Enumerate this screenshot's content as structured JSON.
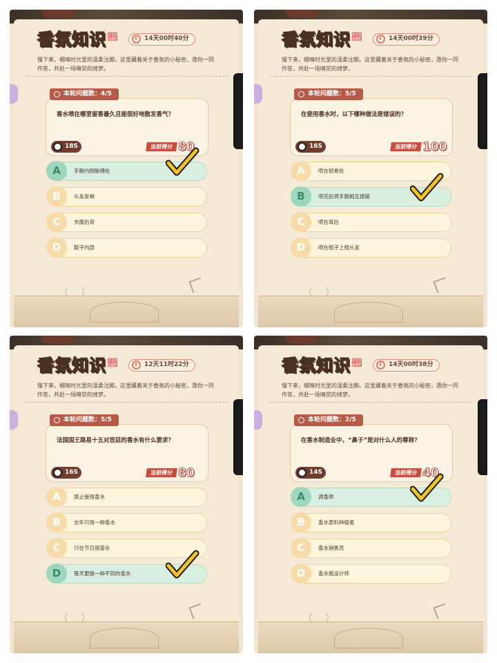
{
  "title_part1": "香氛",
  "title_part2": "知识",
  "description": "慢下来，细嗅时光里的温柔注脚。这里藏着关于香氛的小秘密，邀你一同作答，共赴一场嗅觉的绮梦。",
  "score_label": "当前得分",
  "colors": {
    "accent": "#b85a48",
    "correct": "#d8efe2",
    "option": "#fdf6dc",
    "check": "#f3c22b"
  },
  "panels": [
    {
      "timer": "14天00时40分",
      "round": "本轮问题数：4/5",
      "question": "香水喷在哪里留香最久且能很好地散发香气？",
      "time_left": "18S",
      "score": "80",
      "correct_index": 0,
      "options": [
        {
          "letter": "A",
          "text": "手腕内侧脉搏处"
        },
        {
          "letter": "B",
          "text": "头发发梢"
        },
        {
          "letter": "C",
          "text": "衣服后背"
        },
        {
          "letter": "D",
          "text": "鞋子内部"
        }
      ]
    },
    {
      "timer": "14天00时39分",
      "round": "本轮问题数：5/5",
      "question": "在使用香水时，以下哪种做法是错误的？",
      "time_left": "16S",
      "score": "100",
      "correct_index": 1,
      "options": [
        {
          "letter": "A",
          "text": "喷在锁骨处"
        },
        {
          "letter": "B",
          "text": "喷完后将手腕相互揉搓"
        },
        {
          "letter": "C",
          "text": "喷在耳后"
        },
        {
          "letter": "D",
          "text": "喷在梳子上梳头发"
        }
      ]
    },
    {
      "timer": "12天11时22分",
      "round": "本轮问题数：5/5",
      "question": "法国国王路易十五对宫廷的香水有什么要求？",
      "time_left": "16S",
      "score": "80",
      "correct_index": 3,
      "options": [
        {
          "letter": "A",
          "text": "禁止使用香水"
        },
        {
          "letter": "B",
          "text": "全年只用一种香水"
        },
        {
          "letter": "C",
          "text": "只在节日用香水"
        },
        {
          "letter": "D",
          "text": "每天更换一种不同的香水"
        }
      ]
    },
    {
      "timer": "14天00时38分",
      "round": "本轮问题数：2/5",
      "question": "在香水制造业中，“鼻子”是对什么人的尊称？",
      "time_left": "14S",
      "score": "40",
      "correct_index": 0,
      "options": [
        {
          "letter": "A",
          "text": "调香师"
        },
        {
          "letter": "B",
          "text": "香水原料种植者"
        },
        {
          "letter": "C",
          "text": "香水销售员"
        },
        {
          "letter": "D",
          "text": "香水瓶设计师"
        }
      ]
    }
  ]
}
